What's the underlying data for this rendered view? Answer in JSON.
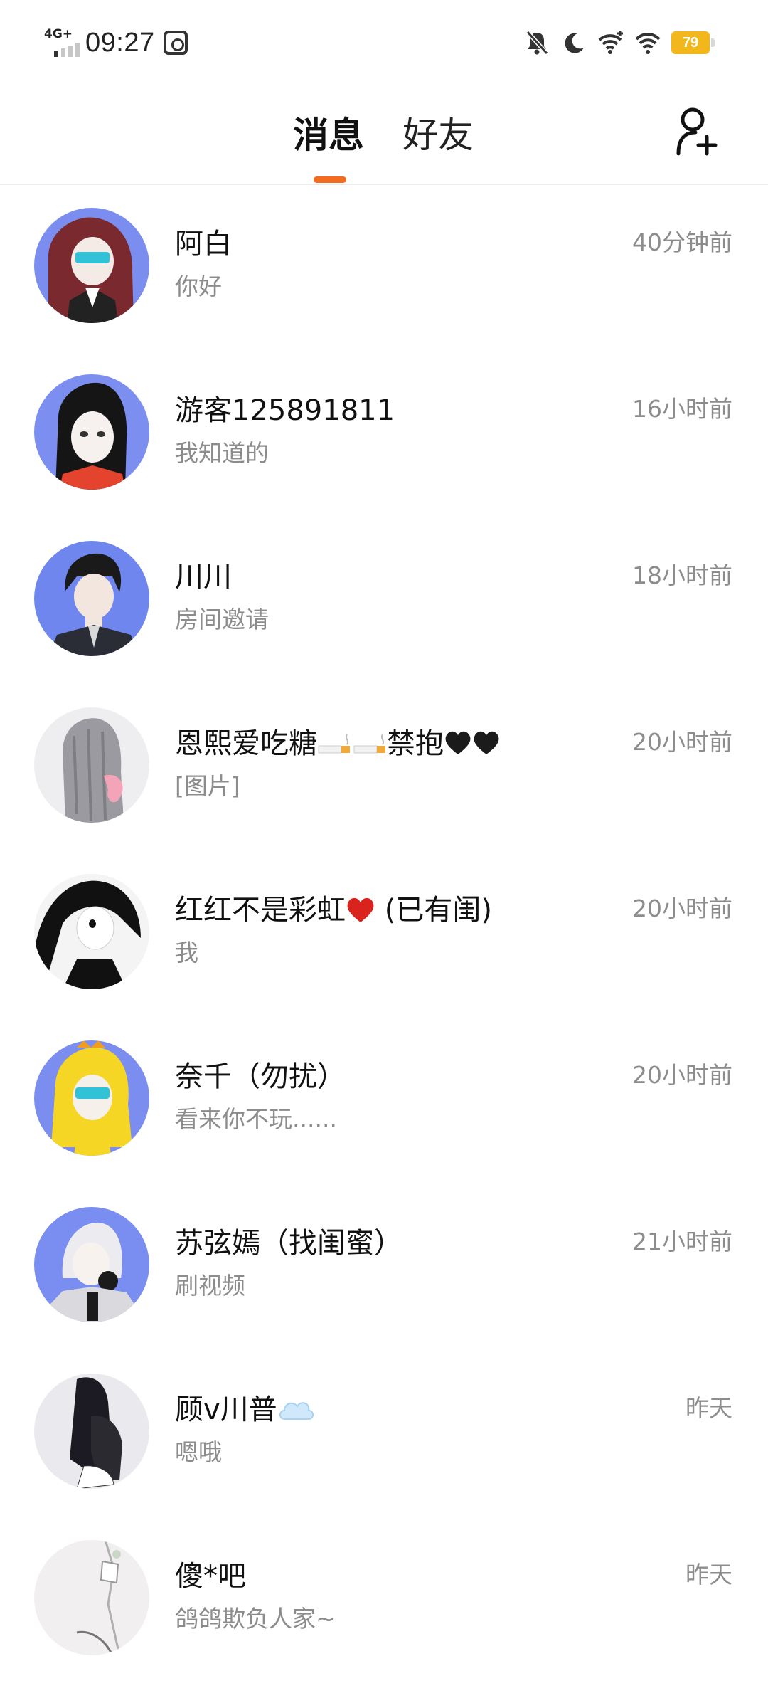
{
  "status_bar": {
    "network": "4G+",
    "time": "09:27",
    "battery": "79",
    "icons": [
      "screen-record-icon",
      "mute-bell-icon",
      "moon-icon",
      "wifi-plus-icon",
      "wifi-icon",
      "battery-icon"
    ]
  },
  "header": {
    "tabs": [
      {
        "label": "消息",
        "active": true
      },
      {
        "label": "好友",
        "active": false
      }
    ],
    "accent": "#f46b1e",
    "add_friend_icon": "add-user-icon"
  },
  "conversations": [
    {
      "name": "阿白",
      "preview": "你好",
      "time": "40分钟前",
      "avatar": "avatar-anime-maroon-hair"
    },
    {
      "name": "游客125891811",
      "preview": "我知道的",
      "time": "16小时前",
      "avatar": "avatar-anime-black-hair"
    },
    {
      "name": "川川",
      "preview": "房间邀请",
      "time": "18小时前",
      "avatar": "avatar-anime-boy"
    },
    {
      "name": "恩熙爱吃糖",
      "name_suffix": "禁抱",
      "preview": "[图片]",
      "time": "20小时前",
      "avatar": "avatar-anime-silver-hair"
    },
    {
      "name": "红红不是彩虹",
      "name_suffix": " (已有闺)",
      "preview": "我",
      "time": "20小时前",
      "avatar": "avatar-anime-monochrome"
    },
    {
      "name": "奈千（勿扰）",
      "preview": "看来你不玩......",
      "time": "20小时前",
      "avatar": "avatar-anime-blonde"
    },
    {
      "name": "苏弦嫣（找闺蜜）",
      "preview": "刷视频",
      "time": "21小时前",
      "avatar": "avatar-anime-white-hair"
    },
    {
      "name": "顾v川普",
      "preview": "嗯哦",
      "time": "昨天",
      "avatar": "avatar-anime-dark-long-hair"
    },
    {
      "name": "傻*吧",
      "preview": "鸽鸽欺负人家~",
      "time": "昨天",
      "avatar": "avatar-anime-sketch"
    }
  ]
}
